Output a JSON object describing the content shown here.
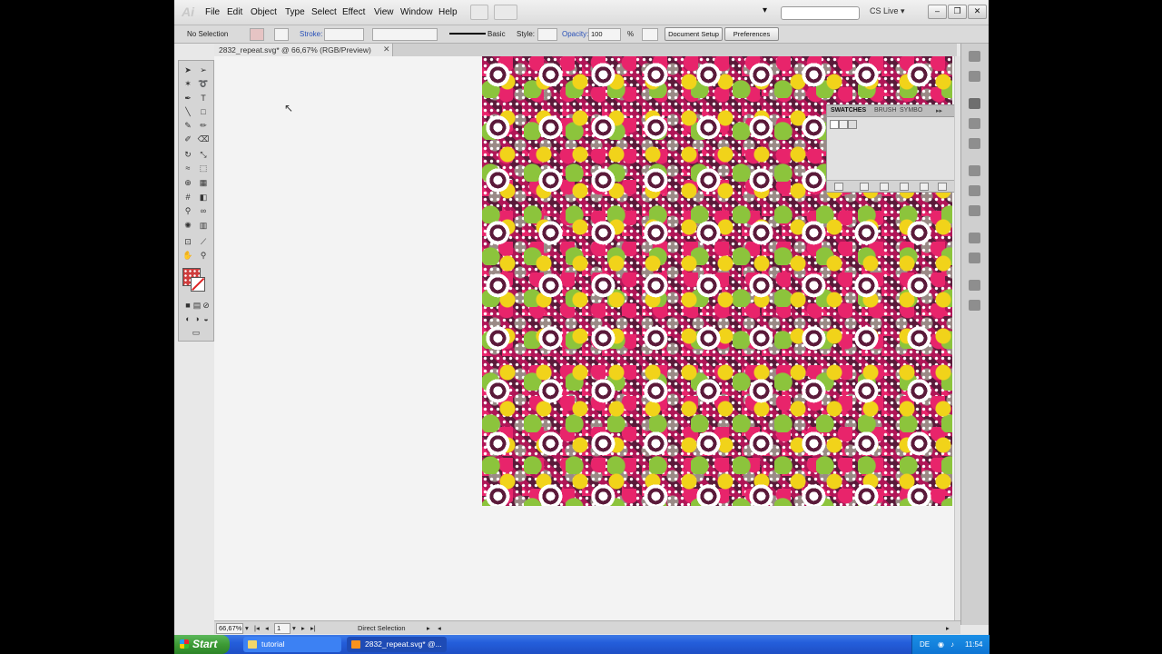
{
  "app": {
    "logo_text": "Ai",
    "menus": [
      "File",
      "Edit",
      "Object",
      "Type",
      "Select",
      "Effect",
      "View",
      "Window",
      "Help"
    ],
    "cs_live": "CS Live",
    "window_buttons": {
      "minimize": "–",
      "restore": "❐",
      "close": "✕"
    }
  },
  "control_bar": {
    "selection_status": "No Selection",
    "stroke_label": "Stroke:",
    "brush_label": "Basic",
    "style_label": "Style:",
    "opacity_label": "Opacity:",
    "opacity_value": "100",
    "opacity_unit": "%",
    "document_setup": "Document Setup",
    "preferences": "Preferences"
  },
  "document_tab": {
    "title": "2832_repeat.svg* @ 66,67% (RGB/Preview)",
    "close": "✕"
  },
  "swatches_panel": {
    "tabs": [
      "SWATCHES",
      "BRUSH",
      "SYMBO"
    ]
  },
  "status_bar": {
    "zoom": "66,67%",
    "page": "1",
    "tool": "Direct Selection"
  },
  "taskbar": {
    "start": "Start",
    "buttons": [
      "tutorial",
      "2832_repeat.svg* @..."
    ],
    "language": "DE",
    "clock": "11:54"
  },
  "colors": {
    "artwork_magenta": "#b01657",
    "artwork_pink": "#e8246b",
    "artwork_yellow": "#f1d31a",
    "artwork_green": "#8cc43c",
    "artwork_plum": "#5b1a3a",
    "taskbar_blue": "#245edb",
    "start_green": "#3d9b35"
  }
}
